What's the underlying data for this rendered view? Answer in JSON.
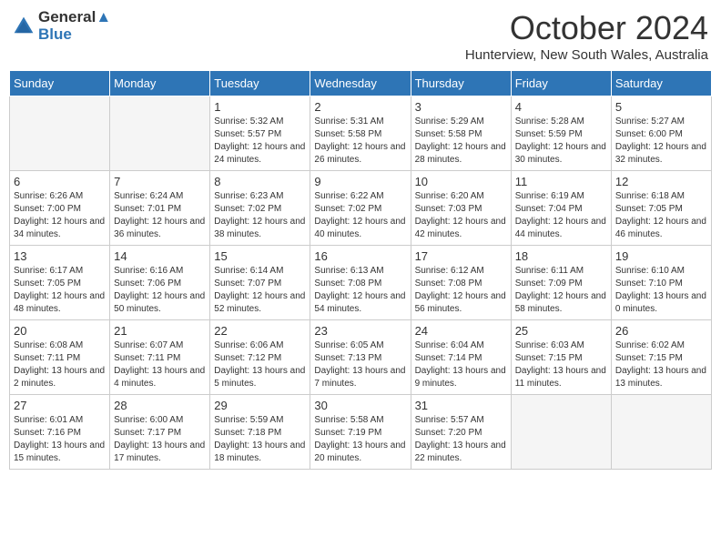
{
  "logo": {
    "line1": "General",
    "line2": "Blue"
  },
  "title": "October 2024",
  "location": "Hunterview, New South Wales, Australia",
  "headers": [
    "Sunday",
    "Monday",
    "Tuesday",
    "Wednesday",
    "Thursday",
    "Friday",
    "Saturday"
  ],
  "weeks": [
    [
      {
        "day": "",
        "detail": ""
      },
      {
        "day": "",
        "detail": ""
      },
      {
        "day": "1",
        "detail": "Sunrise: 5:32 AM\nSunset: 5:57 PM\nDaylight: 12 hours\nand 24 minutes."
      },
      {
        "day": "2",
        "detail": "Sunrise: 5:31 AM\nSunset: 5:58 PM\nDaylight: 12 hours\nand 26 minutes."
      },
      {
        "day": "3",
        "detail": "Sunrise: 5:29 AM\nSunset: 5:58 PM\nDaylight: 12 hours\nand 28 minutes."
      },
      {
        "day": "4",
        "detail": "Sunrise: 5:28 AM\nSunset: 5:59 PM\nDaylight: 12 hours\nand 30 minutes."
      },
      {
        "day": "5",
        "detail": "Sunrise: 5:27 AM\nSunset: 6:00 PM\nDaylight: 12 hours\nand 32 minutes."
      }
    ],
    [
      {
        "day": "6",
        "detail": "Sunrise: 6:26 AM\nSunset: 7:00 PM\nDaylight: 12 hours\nand 34 minutes."
      },
      {
        "day": "7",
        "detail": "Sunrise: 6:24 AM\nSunset: 7:01 PM\nDaylight: 12 hours\nand 36 minutes."
      },
      {
        "day": "8",
        "detail": "Sunrise: 6:23 AM\nSunset: 7:02 PM\nDaylight: 12 hours\nand 38 minutes."
      },
      {
        "day": "9",
        "detail": "Sunrise: 6:22 AM\nSunset: 7:02 PM\nDaylight: 12 hours\nand 40 minutes."
      },
      {
        "day": "10",
        "detail": "Sunrise: 6:20 AM\nSunset: 7:03 PM\nDaylight: 12 hours\nand 42 minutes."
      },
      {
        "day": "11",
        "detail": "Sunrise: 6:19 AM\nSunset: 7:04 PM\nDaylight: 12 hours\nand 44 minutes."
      },
      {
        "day": "12",
        "detail": "Sunrise: 6:18 AM\nSunset: 7:05 PM\nDaylight: 12 hours\nand 46 minutes."
      }
    ],
    [
      {
        "day": "13",
        "detail": "Sunrise: 6:17 AM\nSunset: 7:05 PM\nDaylight: 12 hours\nand 48 minutes."
      },
      {
        "day": "14",
        "detail": "Sunrise: 6:16 AM\nSunset: 7:06 PM\nDaylight: 12 hours\nand 50 minutes."
      },
      {
        "day": "15",
        "detail": "Sunrise: 6:14 AM\nSunset: 7:07 PM\nDaylight: 12 hours\nand 52 minutes."
      },
      {
        "day": "16",
        "detail": "Sunrise: 6:13 AM\nSunset: 7:08 PM\nDaylight: 12 hours\nand 54 minutes."
      },
      {
        "day": "17",
        "detail": "Sunrise: 6:12 AM\nSunset: 7:08 PM\nDaylight: 12 hours\nand 56 minutes."
      },
      {
        "day": "18",
        "detail": "Sunrise: 6:11 AM\nSunset: 7:09 PM\nDaylight: 12 hours\nand 58 minutes."
      },
      {
        "day": "19",
        "detail": "Sunrise: 6:10 AM\nSunset: 7:10 PM\nDaylight: 13 hours\nand 0 minutes."
      }
    ],
    [
      {
        "day": "20",
        "detail": "Sunrise: 6:08 AM\nSunset: 7:11 PM\nDaylight: 13 hours\nand 2 minutes."
      },
      {
        "day": "21",
        "detail": "Sunrise: 6:07 AM\nSunset: 7:11 PM\nDaylight: 13 hours\nand 4 minutes."
      },
      {
        "day": "22",
        "detail": "Sunrise: 6:06 AM\nSunset: 7:12 PM\nDaylight: 13 hours\nand 5 minutes."
      },
      {
        "day": "23",
        "detail": "Sunrise: 6:05 AM\nSunset: 7:13 PM\nDaylight: 13 hours\nand 7 minutes."
      },
      {
        "day": "24",
        "detail": "Sunrise: 6:04 AM\nSunset: 7:14 PM\nDaylight: 13 hours\nand 9 minutes."
      },
      {
        "day": "25",
        "detail": "Sunrise: 6:03 AM\nSunset: 7:15 PM\nDaylight: 13 hours\nand 11 minutes."
      },
      {
        "day": "26",
        "detail": "Sunrise: 6:02 AM\nSunset: 7:15 PM\nDaylight: 13 hours\nand 13 minutes."
      }
    ],
    [
      {
        "day": "27",
        "detail": "Sunrise: 6:01 AM\nSunset: 7:16 PM\nDaylight: 13 hours\nand 15 minutes."
      },
      {
        "day": "28",
        "detail": "Sunrise: 6:00 AM\nSunset: 7:17 PM\nDaylight: 13 hours\nand 17 minutes."
      },
      {
        "day": "29",
        "detail": "Sunrise: 5:59 AM\nSunset: 7:18 PM\nDaylight: 13 hours\nand 18 minutes."
      },
      {
        "day": "30",
        "detail": "Sunrise: 5:58 AM\nSunset: 7:19 PM\nDaylight: 13 hours\nand 20 minutes."
      },
      {
        "day": "31",
        "detail": "Sunrise: 5:57 AM\nSunset: 7:20 PM\nDaylight: 13 hours\nand 22 minutes."
      },
      {
        "day": "",
        "detail": ""
      },
      {
        "day": "",
        "detail": ""
      }
    ]
  ]
}
